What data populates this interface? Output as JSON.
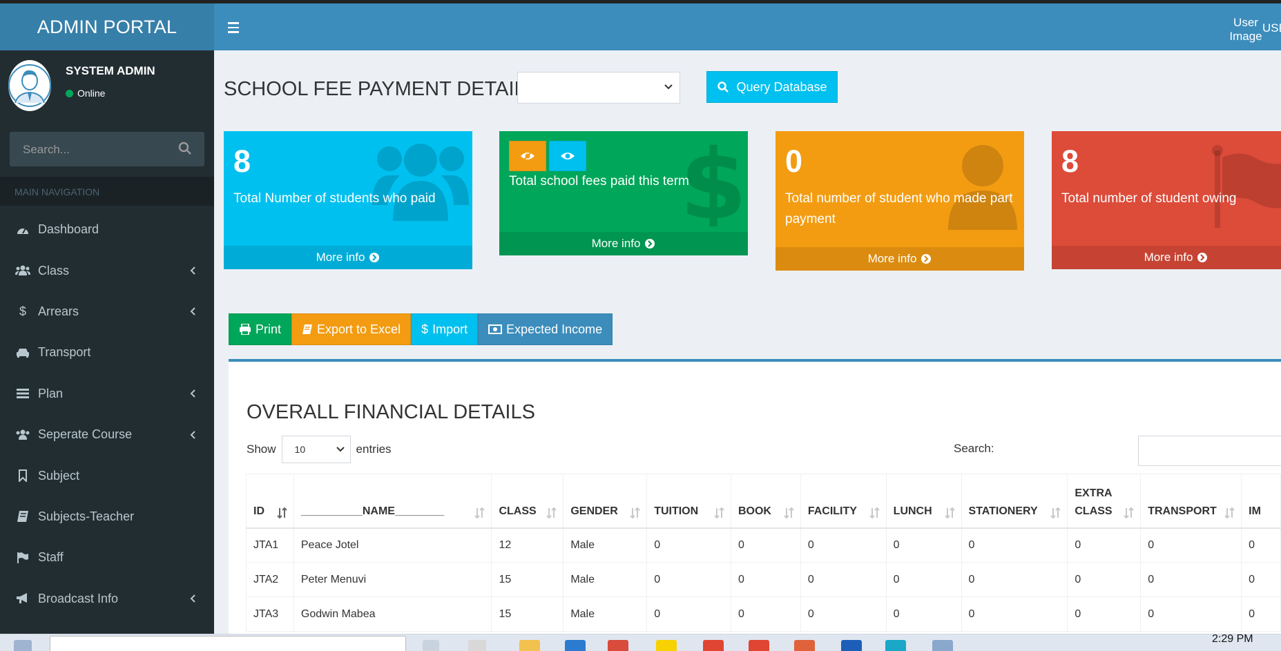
{
  "header": {
    "brand": "ADMIN PORTAL",
    "user_image_alt": "User Image",
    "user_name_partial": "USE"
  },
  "sidebar": {
    "user_name": "SYSTEM ADMIN",
    "status": "Online",
    "search_placeholder": "Search...",
    "section_label": "MAIN NAVIGATION",
    "items": [
      {
        "label": "Dashboard",
        "icon": "dashboard-icon",
        "has_children": false
      },
      {
        "label": "Class",
        "icon": "users-icon",
        "has_children": true
      },
      {
        "label": "Arrears",
        "icon": "dollar-icon",
        "has_children": true
      },
      {
        "label": "Transport",
        "icon": "car-icon",
        "has_children": false
      },
      {
        "label": "Plan",
        "icon": "list-icon",
        "has_children": true
      },
      {
        "label": "Seperate Course",
        "icon": "users-icon",
        "has_children": true
      },
      {
        "label": "Subject",
        "icon": "bookmark-icon",
        "has_children": false
      },
      {
        "label": "Subjects-Teacher",
        "icon": "book-icon",
        "has_children": false
      },
      {
        "label": "Staff",
        "icon": "flag-icon",
        "has_children": false
      },
      {
        "label": "Broadcast Info",
        "icon": "bullhorn-icon",
        "has_children": true
      }
    ]
  },
  "main": {
    "title": "SCHOOL FEE PAYMENT DETAILS",
    "query_button": "Query Database",
    "stat_boxes": [
      {
        "value": "8",
        "text": "Total Number of students who paid",
        "footer": "More info",
        "color": "#00c0ef",
        "icon": "users-icon"
      },
      {
        "value": "",
        "text": "Total school fees paid this term",
        "footer": "More info",
        "color": "#00a65a",
        "icon": "dollar-icon"
      },
      {
        "value": "0",
        "text": "Total number of student who made part payment",
        "footer": "More info",
        "color": "#f39c12",
        "icon": "user-icon"
      },
      {
        "value": "8",
        "text": "Total number of student owing",
        "footer": "More info",
        "color": "#dd4b39",
        "icon": "flag-icon"
      }
    ],
    "actions": {
      "print": "Print",
      "export": "Export to Excel",
      "import": "Import",
      "expected_income": "Expected Income"
    },
    "panel_title": "OVERALL FINANCIAL DETAILS",
    "length": {
      "prefix": "Show",
      "value": "10",
      "suffix": "entries"
    },
    "search_label": "Search:",
    "table": {
      "headers": [
        "ID",
        "__________NAME________",
        "CLASS",
        "GENDER",
        "TUITION",
        "BOOK",
        "FACILITY",
        "LUNCH",
        "STATIONERY",
        "EXTRA CLASS",
        "TRANSPORT",
        "IM"
      ],
      "rows": [
        [
          "JTA1",
          "Peace Jotel",
          "12",
          "Male",
          "0",
          "0",
          "0",
          "0",
          "0",
          "0",
          "0",
          "0"
        ],
        [
          "JTA2",
          "Peter Menuvi",
          "15",
          "Male",
          "0",
          "0",
          "0",
          "0",
          "0",
          "0",
          "0",
          "0"
        ],
        [
          "JTA3",
          "Godwin Mabea",
          "15",
          "Male",
          "0",
          "0",
          "0",
          "0",
          "0",
          "0",
          "0",
          "0"
        ]
      ]
    }
  },
  "taskbar": {
    "time": "2:29 PM"
  }
}
